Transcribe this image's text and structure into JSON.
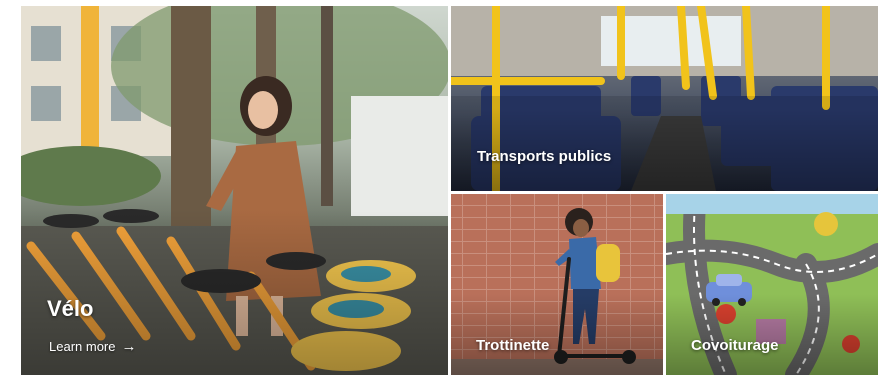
{
  "tiles": {
    "velo": {
      "title": "Vélo",
      "link_label": "Learn more",
      "link_icon": "arrow-right-icon"
    },
    "transport": {
      "title": "Transports publics"
    },
    "trottinette": {
      "title": "Trottinette"
    },
    "covoiturage": {
      "title": "Covoiturage"
    }
  },
  "colors": {
    "caption_text": "#ffffff",
    "bike_yellow": "#f2a23a",
    "bus_pole_yellow": "#f1c31b",
    "bus_seat_blue": "#2a3a6b",
    "brick": "#b9705a",
    "mat_green": "#8fbf57"
  }
}
